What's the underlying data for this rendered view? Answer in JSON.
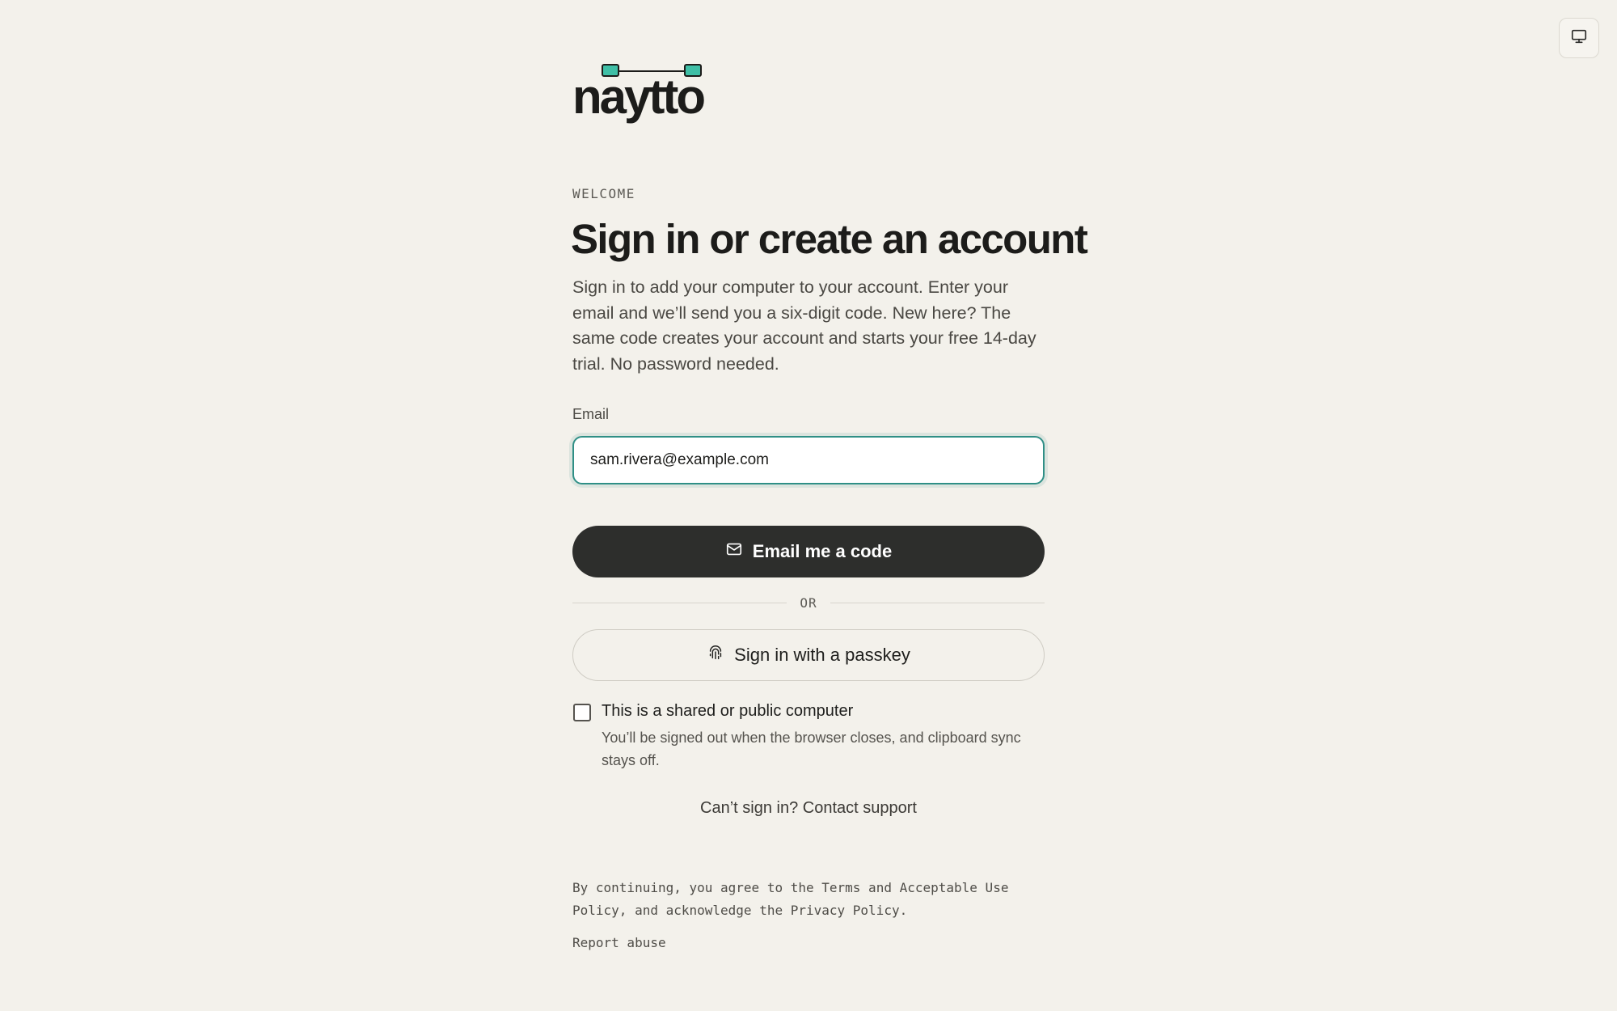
{
  "brand": {
    "name": "naytto",
    "accent_color": "#3fbfa6"
  },
  "header": {
    "display_icon": "monitor-icon"
  },
  "welcome": {
    "eyebrow": "WELCOME",
    "title": "Sign in or create an account",
    "intro": "Sign in to add your computer to your account. Enter your email and we’ll send you a six-digit code. New here? The same code creates your account and starts your free 14-day trial. No password needed."
  },
  "email": {
    "label": "Email",
    "value": "sam.rivera@example.com"
  },
  "actions": {
    "email_code_label": "Email me a code",
    "email_code_icon": "mail-icon",
    "divider_text": "OR",
    "passkey_label": "Sign in with a passkey",
    "passkey_icon": "fingerprint-icon"
  },
  "shared_computer": {
    "checked": false,
    "label": "This is a shared or public computer",
    "help": "You’ll be signed out when the browser closes, and clipboard sync stays off."
  },
  "support": {
    "text": "Can’t sign in? Contact support"
  },
  "legal": {
    "part1": "By continuing, you agree to the ",
    "terms": "Terms",
    "part2": " and ",
    "aup": "Acceptable Use Policy",
    "part3": ", and acknowledge the ",
    "privacy": "Privacy Policy",
    "part4": ".",
    "report": "Report abuse"
  },
  "colors": {
    "background": "#f3f1eb",
    "primary_button": "#2d2e2c",
    "focus_border": "#2f8f86"
  }
}
